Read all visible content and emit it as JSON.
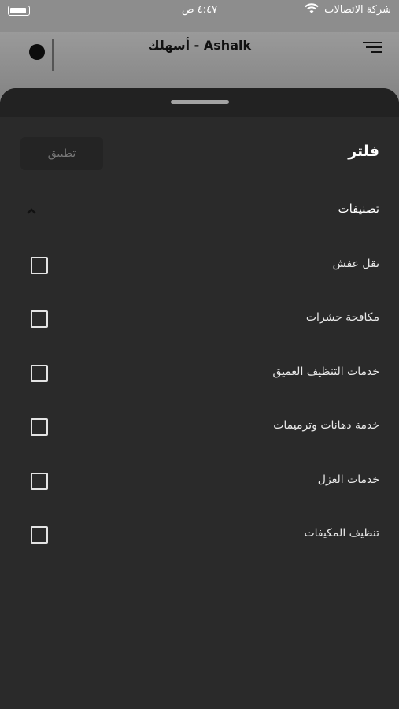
{
  "status_bar": {
    "carrier": "شركة الاتصالات",
    "time": "٤:٤٧ ص"
  },
  "app_header": {
    "title": "أسهلك - Ashalk"
  },
  "filter": {
    "title": "فلتر",
    "apply_label": "تطبيق",
    "section_title": "تصنيفات",
    "categories": [
      {
        "label": "نقل عفش",
        "checked": false
      },
      {
        "label": "مكافحة حشرات",
        "checked": false
      },
      {
        "label": "خدمات التنظيف العميق",
        "checked": false
      },
      {
        "label": "خدمة دهانات وترميمات",
        "checked": false
      },
      {
        "label": "خدمات العزل",
        "checked": false
      },
      {
        "label": "تنظيف المكيفات",
        "checked": false
      }
    ]
  }
}
